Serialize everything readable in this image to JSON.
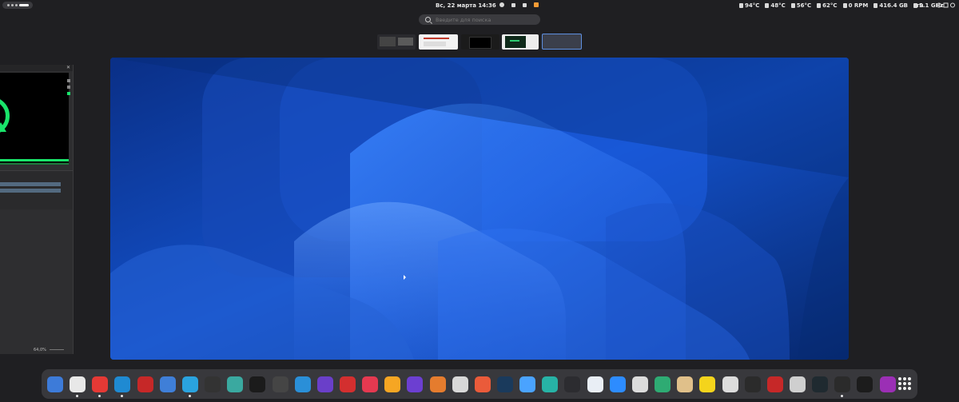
{
  "topbar": {
    "datetime": "Вс, 22 марта  14:36",
    "sensors": [
      {
        "icon": "thermometer-icon",
        "label": "94°C"
      },
      {
        "icon": "thermometer-icon",
        "label": "48°C"
      },
      {
        "icon": "thermometer-icon",
        "label": "56°C"
      },
      {
        "icon": "thermometer-icon",
        "label": "62°C"
      },
      {
        "icon": "fan-icon",
        "label": "0 RPM"
      },
      {
        "icon": "memory-icon",
        "label": "416.4 GB"
      },
      {
        "icon": "cpu-icon",
        "label": "5.1 GHz"
      }
    ],
    "language": "ru"
  },
  "search": {
    "placeholder": "Введите для поиска"
  },
  "left_window": {
    "zoom": "64,0%"
  },
  "dock": {
    "apps": [
      {
        "name": "files",
        "color": "#3d7bd9"
      },
      {
        "name": "chrome",
        "color": "#e8e8e8",
        "running": true
      },
      {
        "name": "youtube-music",
        "color": "#e53935",
        "running": true
      },
      {
        "name": "vscode",
        "color": "#1f8ad2",
        "running": true
      },
      {
        "name": "retro-game",
        "color": "#c62828"
      },
      {
        "name": "bluebubble",
        "color": "#3f7fd8"
      },
      {
        "name": "telegram",
        "color": "#2aa3df",
        "running": true
      },
      {
        "name": "davinci-resolve",
        "color": "#333333"
      },
      {
        "name": "appimage",
        "color": "#3aa9a0"
      },
      {
        "name": "headphones",
        "color": "#1b1b1b"
      },
      {
        "name": "obs",
        "color": "#454545"
      },
      {
        "name": "kdenlive",
        "color": "#2a8fd8"
      },
      {
        "name": "visual-studio",
        "color": "#6a3fc9"
      },
      {
        "name": "downloader",
        "color": "#d32f2f"
      },
      {
        "name": "video-player",
        "color": "#e53950"
      },
      {
        "name": "color-picker",
        "color": "#f6a623"
      },
      {
        "name": "obsidian",
        "color": "#6c3fd1"
      },
      {
        "name": "notes",
        "color": "#e57c2e"
      },
      {
        "name": "storage",
        "color": "#d8d8d8"
      },
      {
        "name": "gitkraken",
        "color": "#ea5b3a"
      },
      {
        "name": "steam",
        "color": "#1a3a5c"
      },
      {
        "name": "vpn-shield",
        "color": "#4aa3ff"
      },
      {
        "name": "dbeaver",
        "color": "#27b3a6"
      },
      {
        "name": "kde-connect",
        "color": "#2c2c30"
      },
      {
        "name": "flutter",
        "color": "#e9eef5"
      },
      {
        "name": "zoom",
        "color": "#2d8cff"
      },
      {
        "name": "multipass",
        "color": "#dcdcdc"
      },
      {
        "name": "cloud-app",
        "color": "#2eab73"
      },
      {
        "name": "gimp-icon",
        "color": "#e0c08a"
      },
      {
        "name": "lambda",
        "color": "#f4d41c"
      },
      {
        "name": "screenshot",
        "color": "#dcdcdc"
      },
      {
        "name": "speedometer",
        "color": "#2b2b2b"
      },
      {
        "name": "filezilla",
        "color": "#c62828"
      },
      {
        "name": "system-tools",
        "color": "#cfcfcf"
      },
      {
        "name": "record",
        "color": "#1f2a30"
      },
      {
        "name": "terminal",
        "color": "#2b2b2b",
        "running": true
      },
      {
        "name": "box-app",
        "color": "#1c1c1c"
      },
      {
        "name": "media-player",
        "color": "#9b2fb5"
      }
    ]
  }
}
